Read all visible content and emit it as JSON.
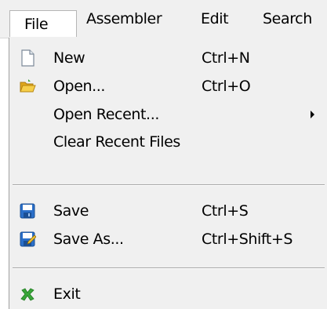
{
  "menubar": {
    "items": [
      {
        "label": "File"
      },
      {
        "label": "Assembler"
      },
      {
        "label": "Edit"
      },
      {
        "label": "Search"
      }
    ]
  },
  "file_menu": {
    "items": [
      {
        "label": "New",
        "shortcut": "Ctrl+N",
        "icon": "new-file-icon"
      },
      {
        "label": "Open...",
        "shortcut": "Ctrl+O",
        "icon": "open-folder-icon"
      },
      {
        "label": "Open Recent...",
        "has_submenu": true
      },
      {
        "label": "Clear Recent Files"
      },
      {
        "label": "Save",
        "shortcut": "Ctrl+S",
        "icon": "save-icon"
      },
      {
        "label": "Save As...",
        "shortcut": "Ctrl+Shift+S",
        "icon": "save-as-icon"
      },
      {
        "label": "Exit",
        "icon": "exit-icon"
      }
    ]
  },
  "colors": {
    "menu_background": "#f0f0f0",
    "save_icon_blue": "#2a6fc9",
    "exit_icon_green": "#3aa63a",
    "folder_yellow": "#f2c232"
  }
}
